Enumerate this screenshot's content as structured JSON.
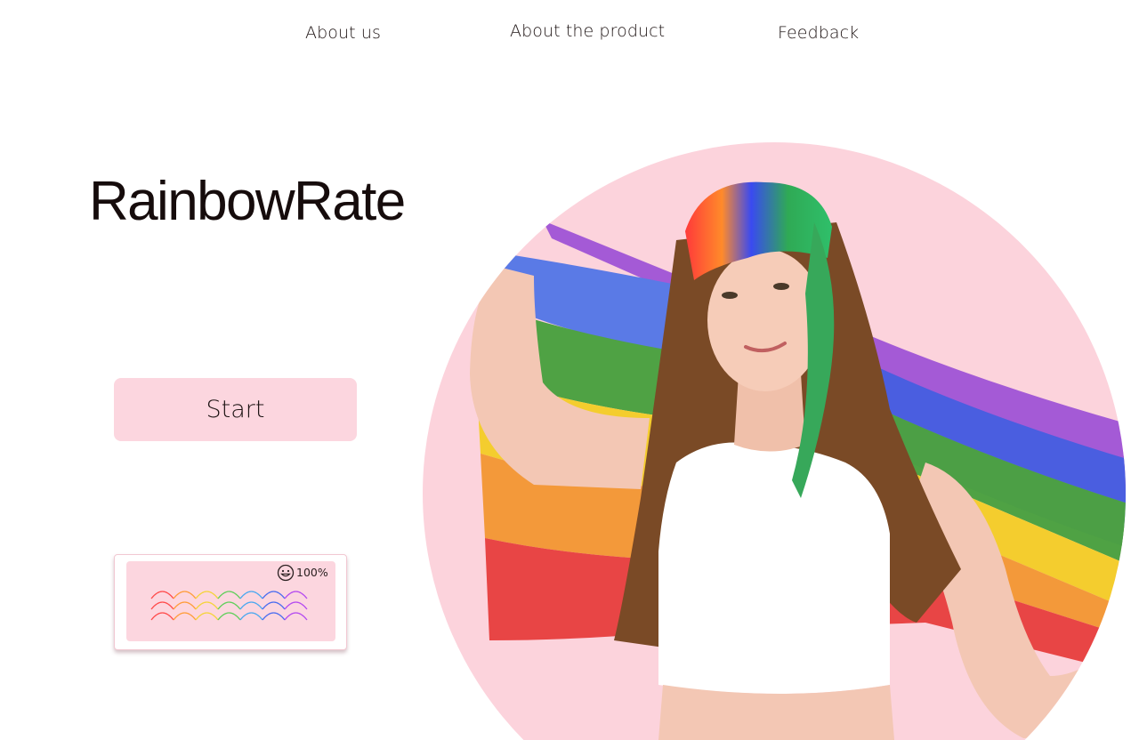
{
  "nav": {
    "about_us": "About us",
    "about_product": "About the product",
    "feedback": "Feedback"
  },
  "brand": {
    "title": "RainbowRate"
  },
  "start_button": {
    "label": "Start"
  },
  "rating_widget": {
    "percent_text": "100%",
    "icon": "smiley-icon",
    "wave_colors": [
      "#ff4b4b",
      "#ff9d3a",
      "#f5d43a",
      "#5fcf5a",
      "#4aa8f0",
      "#4a6cf0",
      "#b44af0"
    ]
  },
  "hero": {
    "image": "person-with-rainbow-flag",
    "circle_color": "#fcd3dc",
    "flag_colors": [
      "#e84040",
      "#f59a3a",
      "#f6cf2f",
      "#4ea045",
      "#4a73e0",
      "#9b55d8"
    ]
  }
}
